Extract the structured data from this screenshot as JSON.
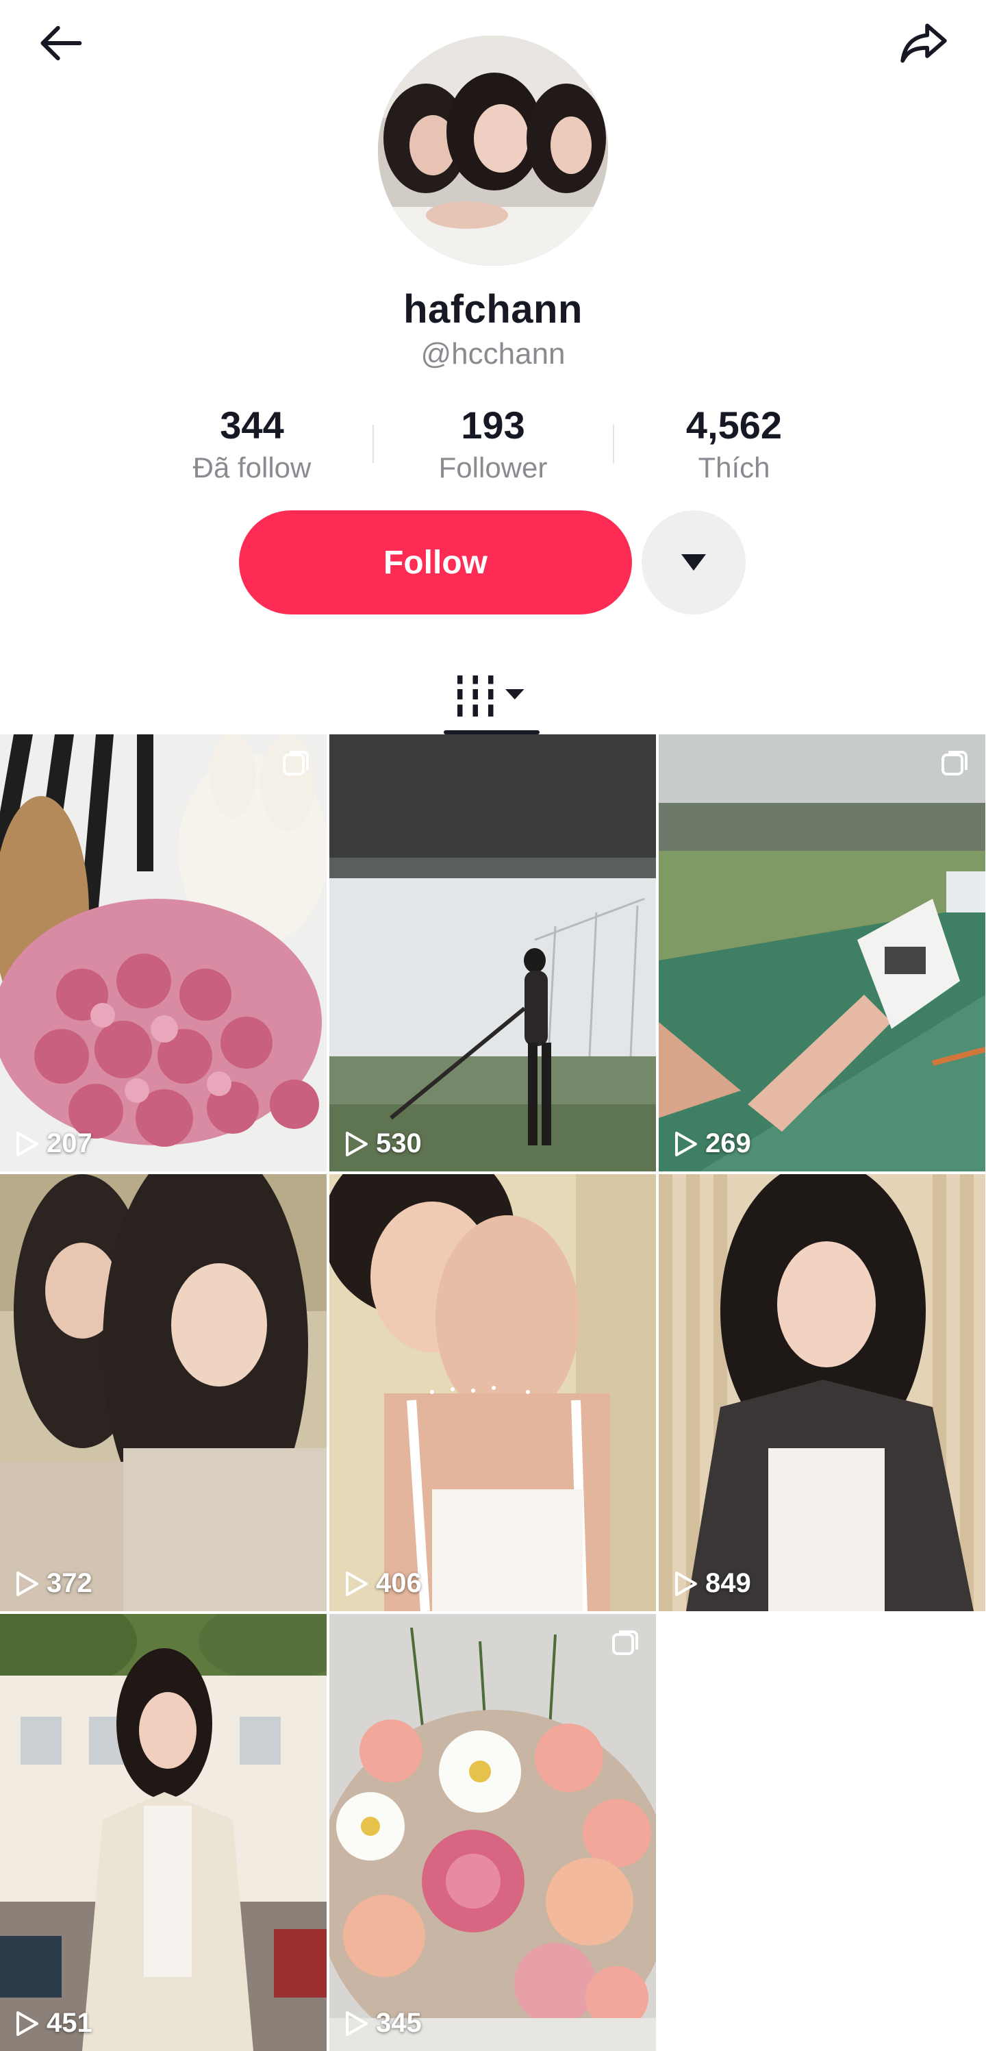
{
  "profile": {
    "display_name": "hafchann",
    "handle": "@hcchann"
  },
  "stats": [
    {
      "value": "344",
      "label": "Đã follow"
    },
    {
      "value": "193",
      "label": "Follower"
    },
    {
      "value": "4,562",
      "label": "Thích"
    }
  ],
  "actions": {
    "follow_label": "Follow"
  },
  "icons": {
    "back": "arrow-left-icon",
    "share": "share-arrow-icon",
    "dropdown": "caret-down-icon",
    "videos_tab": "grid-bars-icon",
    "play": "play-outline-icon",
    "multi": "photo-carousel-icon"
  },
  "colors": {
    "accent": "#fe2c55",
    "text": "#161823",
    "muted": "#8a8b91"
  },
  "videos": [
    {
      "views": "207",
      "multi": true
    },
    {
      "views": "530",
      "multi": false
    },
    {
      "views": "269",
      "multi": true
    },
    {
      "views": "372",
      "multi": false
    },
    {
      "views": "406",
      "multi": false
    },
    {
      "views": "849",
      "multi": false
    },
    {
      "views": "451",
      "multi": false
    },
    {
      "views": "345",
      "multi": true
    }
  ]
}
